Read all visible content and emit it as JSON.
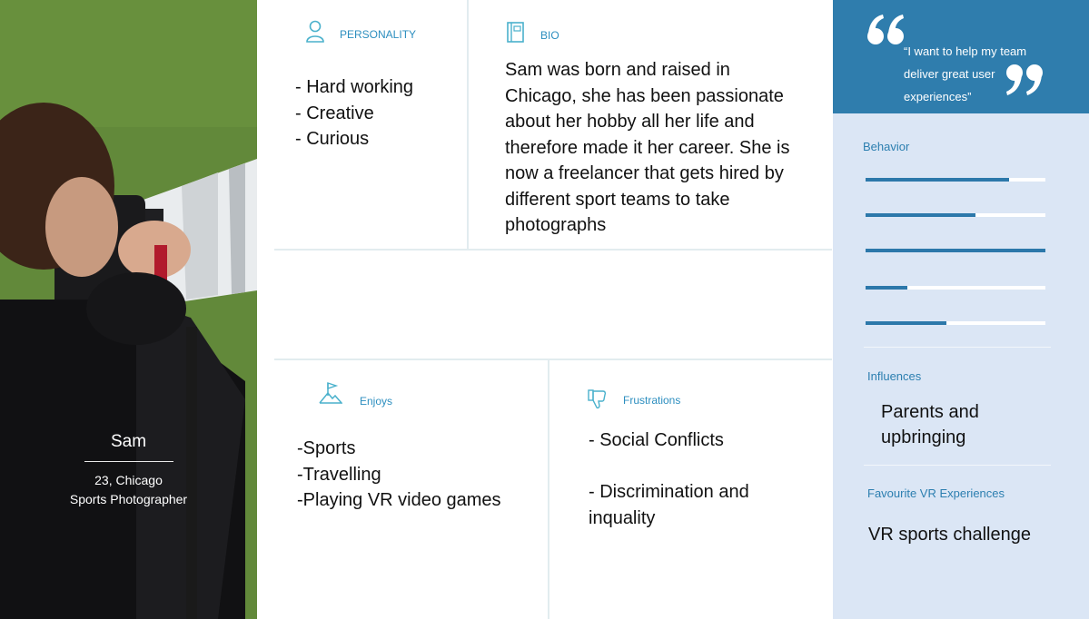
{
  "persona": {
    "name": "Sam",
    "age_location": "23, Chicago",
    "occupation": "Sports Photographer"
  },
  "personality": {
    "label": "PERSONALITY",
    "icon": "person-icon",
    "traits": [
      "- Hard working",
      "- Creative",
      "- Curious"
    ]
  },
  "bio": {
    "label": "BIO",
    "icon": "book-icon",
    "text": "Sam was born and raised in Chicago, she has been passionate about her hobby all her life and therefore made it her career. She is now a freelancer that gets hired by different sport teams to take photographs"
  },
  "enjoys": {
    "label": "Enjoys",
    "icon": "flag-mountain-icon",
    "items": [
      "-Sports",
      "-Travelling",
      "-Playing VR video games"
    ]
  },
  "frustrations": {
    "label": "Frustrations",
    "icon": "thumbs-down-icon",
    "items": [
      "- Social Conflicts",
      "- Discrimination and inquality"
    ]
  },
  "quote": {
    "text": "“I want to help my team deliver great user experiences”",
    "open_mark": "“",
    "close_mark": "”"
  },
  "behavior": {
    "label": "Behavior",
    "levels": [
      0.8,
      0.61,
      1.0,
      0.23,
      0.45
    ]
  },
  "influences": {
    "label": "Influences",
    "text": "Parents and upbringing"
  },
  "favourite_vr": {
    "label": "Favourite VR Experiences",
    "text": "VR sports challenge"
  },
  "colors": {
    "accent": "#2c8ebf",
    "quote_bg": "#2f7dad",
    "side_bg": "#dbe6f5",
    "bar_fill": "#2c78aa"
  }
}
